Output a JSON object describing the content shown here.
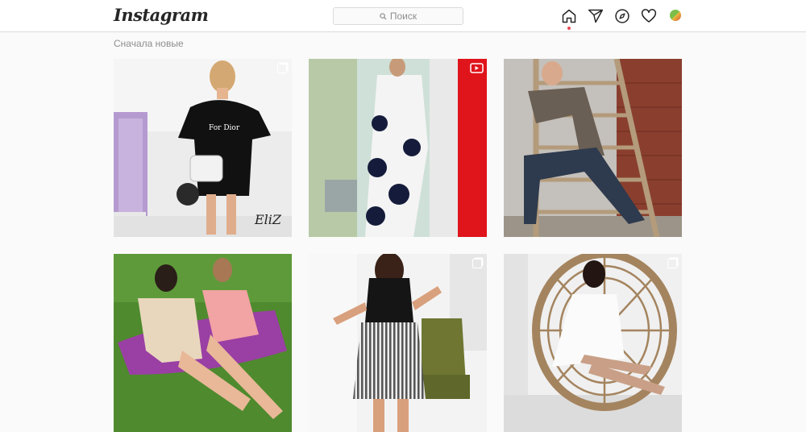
{
  "header": {
    "logo_text": "Instagram",
    "search_placeholder": "Поиск",
    "icons": [
      "home-icon",
      "direct-icon",
      "explore-icon",
      "activity-heart-icon",
      "profile-avatar"
    ]
  },
  "feed": {
    "sort_label": "Сначала новые",
    "posts": [
      {
        "id": "post-1",
        "photo": "woman in black t-shirt dress with white crossbody bag",
        "badge": "multi-photo-icon",
        "watermark": "EliZ"
      },
      {
        "id": "post-2",
        "photo": "woman in white polka dot maxi dress",
        "badge": "reel-icon"
      },
      {
        "id": "post-3",
        "photo": "woman in plaid jacket and jeans on ladder",
        "badge": ""
      },
      {
        "id": "post-4",
        "photo": "two women in off-shoulder dresses on grass",
        "badge": ""
      },
      {
        "id": "post-5",
        "photo": "woman in black top and striped skirt",
        "badge": "multi-photo-icon"
      },
      {
        "id": "post-6",
        "photo": "woman in white lace dress in hanging chair",
        "badge": "multi-photo-icon"
      }
    ]
  },
  "colors": {
    "accent_dot": "#ed4956",
    "border": "#dbdbdb",
    "background": "#fafafa",
    "muted_text": "#8e8e8e"
  }
}
